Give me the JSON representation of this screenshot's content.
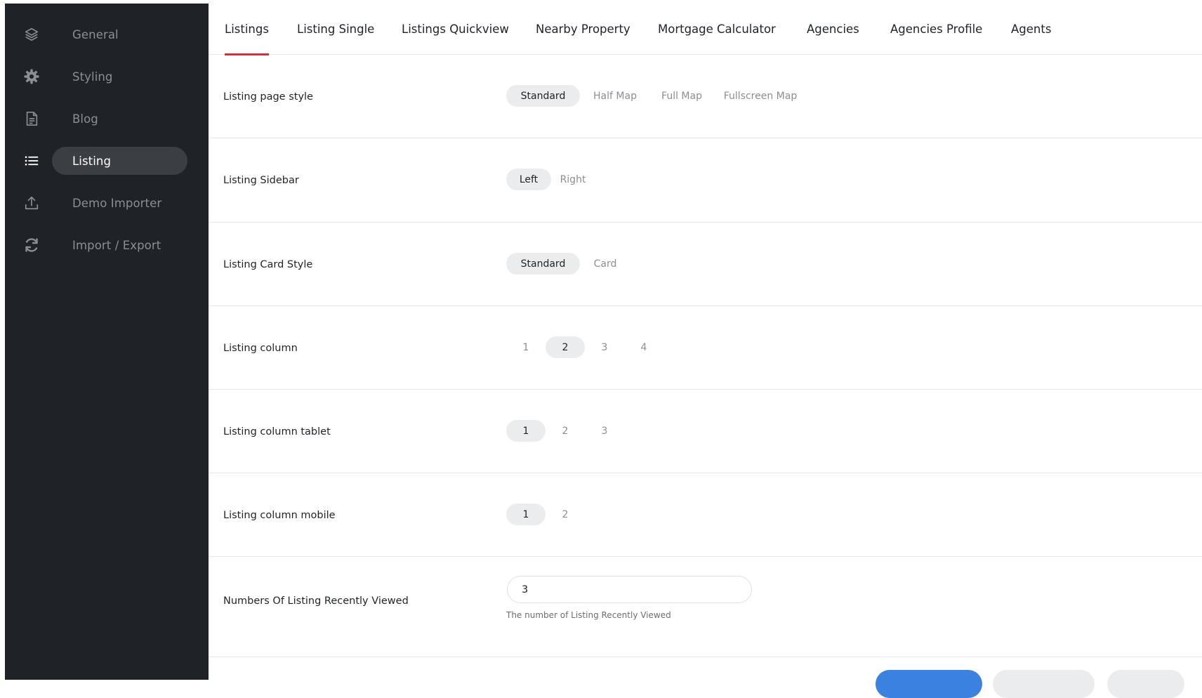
{
  "sidebar": {
    "items": [
      {
        "label": "General",
        "icon": "layers-icon"
      },
      {
        "label": "Styling",
        "icon": "gear-icon"
      },
      {
        "label": "Blog",
        "icon": "document-icon"
      },
      {
        "label": "Listing",
        "icon": "list-icon",
        "active": true
      },
      {
        "label": "Demo Importer",
        "icon": "upload-icon"
      },
      {
        "label": "Import / Export",
        "icon": "sync-icon"
      }
    ]
  },
  "tabs": [
    {
      "label": "Listings",
      "active": true
    },
    {
      "label": "Listing Single"
    },
    {
      "label": "Listings Quickview"
    },
    {
      "label": "Nearby Property"
    },
    {
      "label": "Mortgage Calculator"
    },
    {
      "label": "Agencies"
    },
    {
      "label": "Agencies Profile"
    },
    {
      "label": "Agents"
    }
  ],
  "settings": {
    "page_style": {
      "label": "Listing page style",
      "options": [
        "Standard",
        "Half Map",
        "Full Map",
        "Fullscreen Map"
      ],
      "selected": "Standard"
    },
    "sidebar": {
      "label": "Listing Sidebar",
      "options": [
        "Left",
        "Right"
      ],
      "selected": "Left"
    },
    "card_style": {
      "label": "Listing Card Style",
      "options": [
        "Standard",
        "Card"
      ],
      "selected": "Standard"
    },
    "column": {
      "label": "Listing column",
      "options": [
        "1",
        "2",
        "3",
        "4"
      ],
      "selected": "2"
    },
    "column_tablet": {
      "label": "Listing column tablet",
      "options": [
        "1",
        "2",
        "3"
      ],
      "selected": "1"
    },
    "column_mobile": {
      "label": "Listing column mobile",
      "options": [
        "1",
        "2"
      ],
      "selected": "1"
    },
    "recently_viewed": {
      "label": "Numbers Of Listing Recently Viewed",
      "value": "3",
      "help": "The number of Listing Recently Viewed"
    }
  },
  "colors": {
    "accent_tab": "#d0303a",
    "primary_button": "#3b82e0",
    "sidebar_bg": "#1f2328"
  }
}
